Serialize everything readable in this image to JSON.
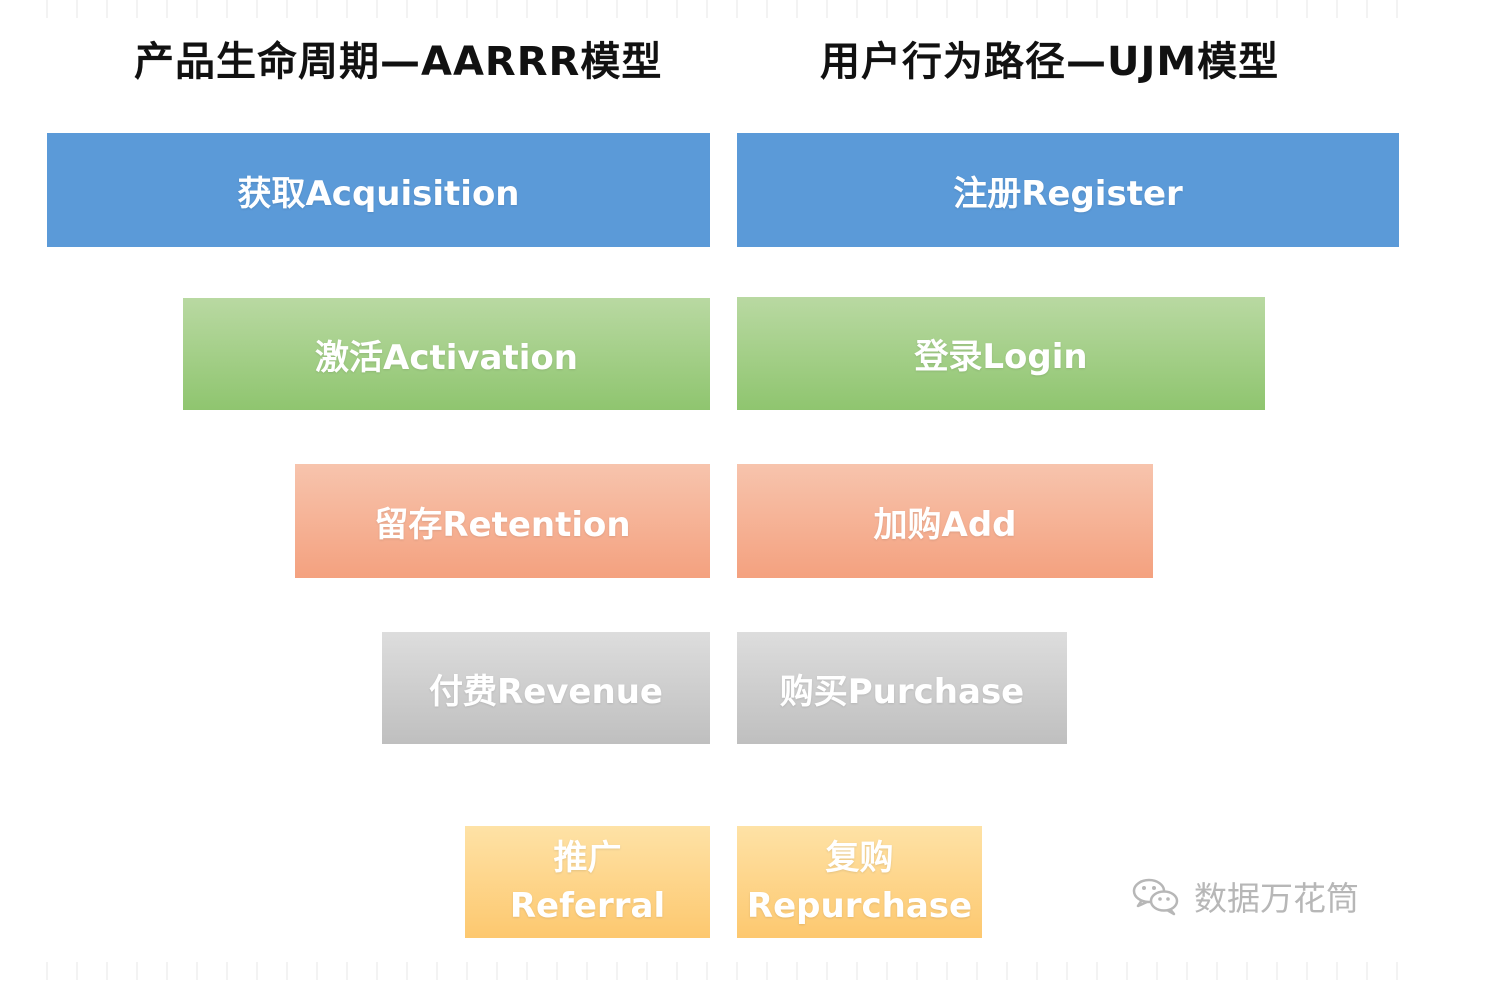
{
  "titles": {
    "left": "产品生命周期—AARRR模型",
    "right": "用户行为路径—UJM模型"
  },
  "left_boxes": [
    {
      "label": "获取Acquisition",
      "color": "#5b9ad8"
    },
    {
      "label": "激活Activation",
      "color": "#a8d08d"
    },
    {
      "label": "留存Retention",
      "color": "#f4b183"
    },
    {
      "label": "付费Revenue",
      "color": "#cfcfcf"
    },
    {
      "line1": "推广",
      "line2": "Referral",
      "color": "#ffd57f"
    }
  ],
  "right_boxes": [
    {
      "label": "注册Register",
      "color": "#5b9ad8"
    },
    {
      "label": "登录Login",
      "color": "#a8d08d"
    },
    {
      "label": "加购Add",
      "color": "#f4b183"
    },
    {
      "label": "购买Purchase",
      "color": "#cfcfcf"
    },
    {
      "line1": "复购",
      "line2": "Repurchase",
      "color": "#ffd57f"
    }
  ],
  "watermark": {
    "text": "数据万花筒",
    "icon": "wechat-icon"
  }
}
